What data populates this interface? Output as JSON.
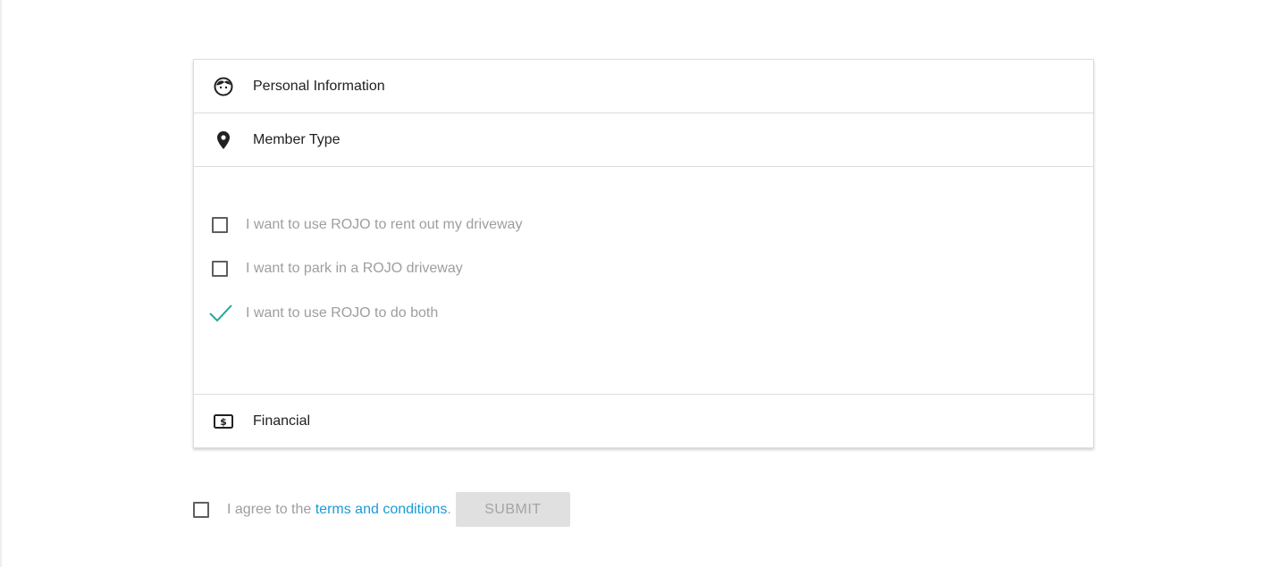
{
  "sections": {
    "personal": {
      "label": "Personal Information",
      "icon": "face-icon"
    },
    "member": {
      "label": "Member Type",
      "icon": "location-pin-icon"
    },
    "financial": {
      "label": "Financial",
      "icon": "money-icon"
    }
  },
  "member_options": [
    {
      "label": "I want to use ROJO to rent out my driveway",
      "checked": false
    },
    {
      "label": "I want to park in a ROJO driveway",
      "checked": false
    },
    {
      "label": "I want to use ROJO to do both",
      "checked": true
    }
  ],
  "agreement": {
    "prefix": "I agree to the ",
    "link": "terms and conditions",
    "suffix": ".",
    "checked": false
  },
  "submit": {
    "label": "SUBMIT",
    "disabled": true
  },
  "colors": {
    "accent": "#26a69a",
    "link": "#1a9ad7",
    "muted_text": "#9e9e9e",
    "button_bg": "#e0e0e0"
  }
}
